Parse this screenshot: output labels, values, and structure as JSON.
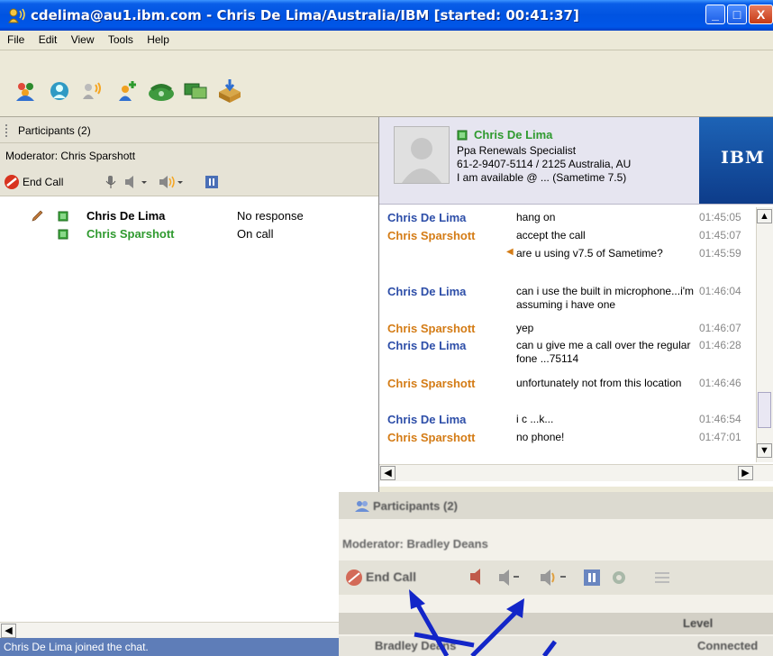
{
  "window": {
    "title": "cdelima@au1.ibm.com - Chris De Lima/Australia/IBM [started: 00:41:37]",
    "buttons": {
      "minimize": "_",
      "maximize": "□",
      "close": "X"
    }
  },
  "menu": [
    "File",
    "Edit",
    "View",
    "Tools",
    "Help"
  ],
  "toolbar": {
    "icons": [
      "people-icon",
      "invite-icon",
      "speaker-people-icon",
      "add-person-icon",
      "phone-icon",
      "screen-share-icon",
      "send-file-icon"
    ]
  },
  "participants": {
    "header": "Participants (2)",
    "moderator": "Moderator: Chris Sparshott",
    "end_call": "End Call",
    "list": [
      {
        "name": "Chris De Lima",
        "status": "No response",
        "color": "#000000"
      },
      {
        "name": "Chris Sparshott",
        "status": "On call",
        "color": "#2f9a2f"
      }
    ]
  },
  "profile": {
    "name": "Chris De Lima",
    "title": "Ppa Renewals Specialist",
    "phone": "61-2-9407-5114 / 2125 Australia, AU",
    "availability": "I am available  @ ... (Sametime 7.5)",
    "brand": "IBM"
  },
  "chat": [
    {
      "who": "Chris De Lima",
      "msg": "hang on",
      "time": "01:45:05",
      "kind": "cdl"
    },
    {
      "who": "Chris Sparshott",
      "msg": "accept the call",
      "time": "01:45:07",
      "kind": "cs"
    },
    {
      "who": "",
      "msg": "are u using v7.5 of Sametime?",
      "time": "01:45:59",
      "kind": "cs"
    },
    {
      "who": "Chris De Lima",
      "msg": "can i use the built in microphone...i'm assuming i have one",
      "time": "01:46:04",
      "kind": "cdl"
    },
    {
      "who": "Chris Sparshott",
      "msg": "yep",
      "time": "01:46:07",
      "kind": "cs"
    },
    {
      "who": "Chris De Lima",
      "msg": "can u give me a call over the regular fone ...75114",
      "time": "01:46:28",
      "kind": "cdl"
    },
    {
      "who": "Chris Sparshott",
      "msg": "unfortunately not from this location",
      "time": "01:46:46",
      "kind": "cs"
    },
    {
      "who": "Chris De Lima",
      "msg": "i c ...k...",
      "time": "01:46:54",
      "kind": "cdl"
    },
    {
      "who": "Chris Sparshott",
      "msg": "no phone!",
      "time": "01:47:01",
      "kind": "cs"
    }
  ],
  "status_bar": "Chris De Lima joined the chat.",
  "inset": {
    "header": "Participants (2)",
    "moderator": "Moderator: Bradley Deans",
    "end_call": "End Call",
    "column_status": "Level",
    "row_name": "Bradley Deans",
    "row_status": "Connected"
  }
}
